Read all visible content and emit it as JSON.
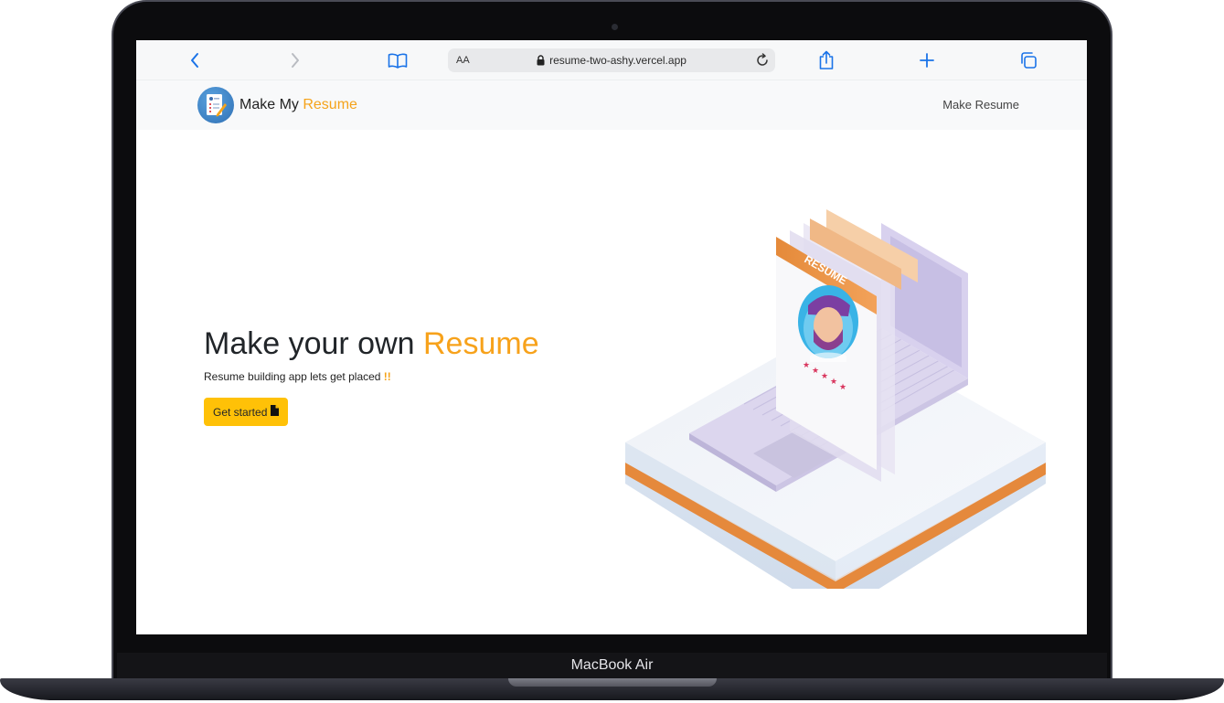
{
  "device": {
    "label": "MacBook Air"
  },
  "browser": {
    "text_size_label": "AA",
    "url": "resume-two-ashy.vercel.app",
    "icons": {
      "back": "chevron-left-icon",
      "forward": "chevron-right-icon",
      "bookmarks": "book-icon",
      "lock": "lock-icon",
      "reload": "reload-icon",
      "share": "share-icon",
      "new_tab": "plus-icon",
      "tabs": "tabs-icon"
    },
    "accent_color": "#1a73e8"
  },
  "navbar": {
    "brand_prefix": "Make My ",
    "brand_accent": "Resume",
    "nav_link": "Make Resume"
  },
  "hero": {
    "title_prefix": "Make your own ",
    "title_accent": "Resume",
    "subtitle": "Resume building app lets get placed ",
    "subtitle_accent": "!!",
    "cta_label": "Get started",
    "cta_icon": "file-icon",
    "illustration_text": "RESUME"
  },
  "colors": {
    "accent": "#f7a21b",
    "button": "#ffc107",
    "navbar_bg": "#f8f9fa"
  }
}
